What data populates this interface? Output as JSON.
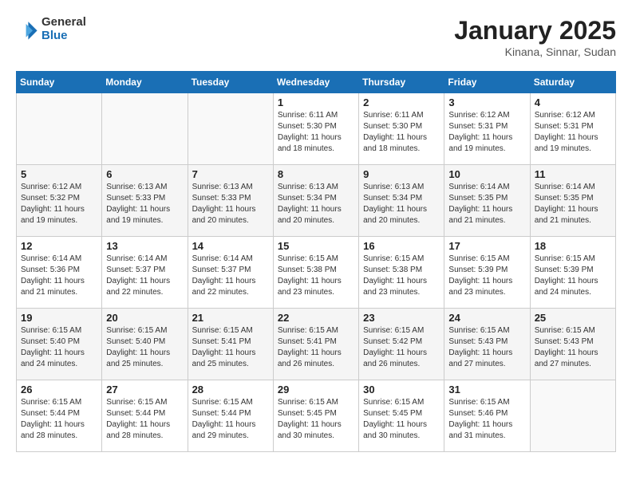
{
  "header": {
    "logo_general": "General",
    "logo_blue": "Blue",
    "month_title": "January 2025",
    "location": "Kinana, Sinnar, Sudan"
  },
  "weekdays": [
    "Sunday",
    "Monday",
    "Tuesday",
    "Wednesday",
    "Thursday",
    "Friday",
    "Saturday"
  ],
  "weeks": [
    [
      {
        "day": "",
        "info": ""
      },
      {
        "day": "",
        "info": ""
      },
      {
        "day": "",
        "info": ""
      },
      {
        "day": "1",
        "info": "Sunrise: 6:11 AM\nSunset: 5:30 PM\nDaylight: 11 hours\nand 18 minutes."
      },
      {
        "day": "2",
        "info": "Sunrise: 6:11 AM\nSunset: 5:30 PM\nDaylight: 11 hours\nand 18 minutes."
      },
      {
        "day": "3",
        "info": "Sunrise: 6:12 AM\nSunset: 5:31 PM\nDaylight: 11 hours\nand 19 minutes."
      },
      {
        "day": "4",
        "info": "Sunrise: 6:12 AM\nSunset: 5:31 PM\nDaylight: 11 hours\nand 19 minutes."
      }
    ],
    [
      {
        "day": "5",
        "info": "Sunrise: 6:12 AM\nSunset: 5:32 PM\nDaylight: 11 hours\nand 19 minutes."
      },
      {
        "day": "6",
        "info": "Sunrise: 6:13 AM\nSunset: 5:33 PM\nDaylight: 11 hours\nand 19 minutes."
      },
      {
        "day": "7",
        "info": "Sunrise: 6:13 AM\nSunset: 5:33 PM\nDaylight: 11 hours\nand 20 minutes."
      },
      {
        "day": "8",
        "info": "Sunrise: 6:13 AM\nSunset: 5:34 PM\nDaylight: 11 hours\nand 20 minutes."
      },
      {
        "day": "9",
        "info": "Sunrise: 6:13 AM\nSunset: 5:34 PM\nDaylight: 11 hours\nand 20 minutes."
      },
      {
        "day": "10",
        "info": "Sunrise: 6:14 AM\nSunset: 5:35 PM\nDaylight: 11 hours\nand 21 minutes."
      },
      {
        "day": "11",
        "info": "Sunrise: 6:14 AM\nSunset: 5:35 PM\nDaylight: 11 hours\nand 21 minutes."
      }
    ],
    [
      {
        "day": "12",
        "info": "Sunrise: 6:14 AM\nSunset: 5:36 PM\nDaylight: 11 hours\nand 21 minutes."
      },
      {
        "day": "13",
        "info": "Sunrise: 6:14 AM\nSunset: 5:37 PM\nDaylight: 11 hours\nand 22 minutes."
      },
      {
        "day": "14",
        "info": "Sunrise: 6:14 AM\nSunset: 5:37 PM\nDaylight: 11 hours\nand 22 minutes."
      },
      {
        "day": "15",
        "info": "Sunrise: 6:15 AM\nSunset: 5:38 PM\nDaylight: 11 hours\nand 23 minutes."
      },
      {
        "day": "16",
        "info": "Sunrise: 6:15 AM\nSunset: 5:38 PM\nDaylight: 11 hours\nand 23 minutes."
      },
      {
        "day": "17",
        "info": "Sunrise: 6:15 AM\nSunset: 5:39 PM\nDaylight: 11 hours\nand 23 minutes."
      },
      {
        "day": "18",
        "info": "Sunrise: 6:15 AM\nSunset: 5:39 PM\nDaylight: 11 hours\nand 24 minutes."
      }
    ],
    [
      {
        "day": "19",
        "info": "Sunrise: 6:15 AM\nSunset: 5:40 PM\nDaylight: 11 hours\nand 24 minutes."
      },
      {
        "day": "20",
        "info": "Sunrise: 6:15 AM\nSunset: 5:40 PM\nDaylight: 11 hours\nand 25 minutes."
      },
      {
        "day": "21",
        "info": "Sunrise: 6:15 AM\nSunset: 5:41 PM\nDaylight: 11 hours\nand 25 minutes."
      },
      {
        "day": "22",
        "info": "Sunrise: 6:15 AM\nSunset: 5:41 PM\nDaylight: 11 hours\nand 26 minutes."
      },
      {
        "day": "23",
        "info": "Sunrise: 6:15 AM\nSunset: 5:42 PM\nDaylight: 11 hours\nand 26 minutes."
      },
      {
        "day": "24",
        "info": "Sunrise: 6:15 AM\nSunset: 5:43 PM\nDaylight: 11 hours\nand 27 minutes."
      },
      {
        "day": "25",
        "info": "Sunrise: 6:15 AM\nSunset: 5:43 PM\nDaylight: 11 hours\nand 27 minutes."
      }
    ],
    [
      {
        "day": "26",
        "info": "Sunrise: 6:15 AM\nSunset: 5:44 PM\nDaylight: 11 hours\nand 28 minutes."
      },
      {
        "day": "27",
        "info": "Sunrise: 6:15 AM\nSunset: 5:44 PM\nDaylight: 11 hours\nand 28 minutes."
      },
      {
        "day": "28",
        "info": "Sunrise: 6:15 AM\nSunset: 5:44 PM\nDaylight: 11 hours\nand 29 minutes."
      },
      {
        "day": "29",
        "info": "Sunrise: 6:15 AM\nSunset: 5:45 PM\nDaylight: 11 hours\nand 30 minutes."
      },
      {
        "day": "30",
        "info": "Sunrise: 6:15 AM\nSunset: 5:45 PM\nDaylight: 11 hours\nand 30 minutes."
      },
      {
        "day": "31",
        "info": "Sunrise: 6:15 AM\nSunset: 5:46 PM\nDaylight: 11 hours\nand 31 minutes."
      },
      {
        "day": "",
        "info": ""
      }
    ]
  ]
}
